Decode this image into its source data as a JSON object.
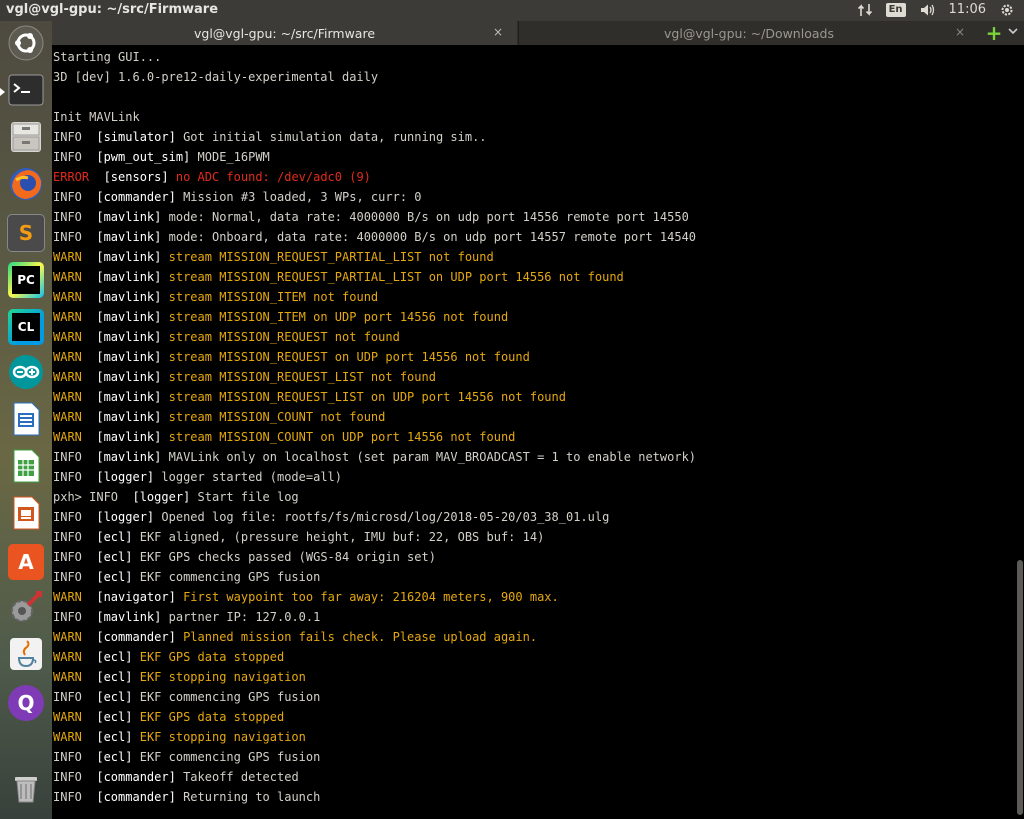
{
  "top_panel": {
    "window_title": "vgl@vgl-gpu: ~/src/Firmware",
    "keyboard_layout": "En",
    "clock": "11:06"
  },
  "launcher": {
    "items": [
      {
        "name": "ubuntu-dash-icon"
      },
      {
        "name": "terminal-icon"
      },
      {
        "name": "files-icon"
      },
      {
        "name": "firefox-icon"
      },
      {
        "name": "sublime-text-icon",
        "glyph": "S"
      },
      {
        "name": "pycharm-icon",
        "glyph": "PC"
      },
      {
        "name": "clion-icon",
        "glyph": "CL"
      },
      {
        "name": "arduino-icon"
      },
      {
        "name": "libreoffice-writer-icon"
      },
      {
        "name": "libreoffice-calc-icon"
      },
      {
        "name": "libreoffice-impress-icon"
      },
      {
        "name": "software-center-icon",
        "glyph": "A"
      },
      {
        "name": "system-settings-icon"
      },
      {
        "name": "java-icon"
      },
      {
        "name": "qgroundcontrol-icon",
        "glyph": "Q"
      },
      {
        "name": "trash-icon"
      }
    ]
  },
  "tabs": [
    {
      "label": "vgl@vgl-gpu: ~/src/Firmware",
      "close": "×"
    },
    {
      "label": "vgl@vgl-gpu: ~/Downloads",
      "close": "×"
    }
  ],
  "colors": {
    "warn": "#e5a80f",
    "error": "#e22a1b",
    "info": "#d3d0c8",
    "module": "#ffffff"
  },
  "lines": [
    {
      "plain": "Starting GUI..."
    },
    {
      "plain": "3D [dev] 1.6.0-pre12-daily-experimental daily"
    },
    {
      "plain": ""
    },
    {
      "plain": "Init MAVLink"
    },
    {
      "level": "INFO",
      "module": "[simulator]",
      "msg": "Got initial simulation data, running sim.."
    },
    {
      "level": "INFO",
      "module": "[pwm_out_sim]",
      "msg": "MODE_16PWM"
    },
    {
      "level": "ERROR",
      "module": "[sensors]",
      "msg": "no ADC found: /dev/adc0 (9)"
    },
    {
      "level": "INFO",
      "module": "[commander]",
      "msg": "Mission #3 loaded, 3 WPs, curr: 0"
    },
    {
      "level": "INFO",
      "module": "[mavlink]",
      "msg": "mode: Normal, data rate: 4000000 B/s on udp port 14556 remote port 14550"
    },
    {
      "level": "INFO",
      "module": "[mavlink]",
      "msg": "mode: Onboard, data rate: 4000000 B/s on udp port 14557 remote port 14540"
    },
    {
      "level": "WARN",
      "module": "[mavlink]",
      "msg": "stream MISSION_REQUEST_PARTIAL_LIST not found"
    },
    {
      "level": "WARN",
      "module": "[mavlink]",
      "msg": "stream MISSION_REQUEST_PARTIAL_LIST on UDP port 14556 not found"
    },
    {
      "level": "WARN",
      "module": "[mavlink]",
      "msg": "stream MISSION_ITEM not found"
    },
    {
      "level": "WARN",
      "module": "[mavlink]",
      "msg": "stream MISSION_ITEM on UDP port 14556 not found"
    },
    {
      "level": "WARN",
      "module": "[mavlink]",
      "msg": "stream MISSION_REQUEST not found"
    },
    {
      "level": "WARN",
      "module": "[mavlink]",
      "msg": "stream MISSION_REQUEST on UDP port 14556 not found"
    },
    {
      "level": "WARN",
      "module": "[mavlink]",
      "msg": "stream MISSION_REQUEST_LIST not found"
    },
    {
      "level": "WARN",
      "module": "[mavlink]",
      "msg": "stream MISSION_REQUEST_LIST on UDP port 14556 not found"
    },
    {
      "level": "WARN",
      "module": "[mavlink]",
      "msg": "stream MISSION_COUNT not found"
    },
    {
      "level": "WARN",
      "module": "[mavlink]",
      "msg": "stream MISSION_COUNT on UDP port 14556 not found"
    },
    {
      "level": "INFO",
      "module": "[mavlink]",
      "msg": "MAVLink only on localhost (set param MAV_BROADCAST = 1 to enable network)"
    },
    {
      "level": "INFO",
      "module": "[logger]",
      "msg": "logger started (mode=all)"
    },
    {
      "prompt": "pxh> ",
      "level": "INFO",
      "module": "[logger]",
      "msg": "Start file log"
    },
    {
      "level": "INFO",
      "module": "[logger]",
      "msg": "Opened log file: rootfs/fs/microsd/log/2018-05-20/03_38_01.ulg"
    },
    {
      "level": "INFO",
      "module": "[ecl]",
      "msg": "EKF aligned, (pressure height, IMU buf: 22, OBS buf: 14)"
    },
    {
      "level": "INFO",
      "module": "[ecl]",
      "msg": "EKF GPS checks passed (WGS-84 origin set)"
    },
    {
      "level": "INFO",
      "module": "[ecl]",
      "msg": "EKF commencing GPS fusion"
    },
    {
      "level": "WARN",
      "module": "[navigator]",
      "msg": "First waypoint too far away: 216204 meters, 900 max."
    },
    {
      "level": "INFO",
      "module": "[mavlink]",
      "msg": "partner IP: 127.0.0.1"
    },
    {
      "level": "WARN",
      "module": "[commander]",
      "msg": "Planned mission fails check. Please upload again."
    },
    {
      "level": "WARN",
      "module": "[ecl]",
      "msg": "EKF GPS data stopped"
    },
    {
      "level": "WARN",
      "module": "[ecl]",
      "msg": "EKF stopping navigation"
    },
    {
      "level": "INFO",
      "module": "[ecl]",
      "msg": "EKF commencing GPS fusion"
    },
    {
      "level": "WARN",
      "module": "[ecl]",
      "msg": "EKF GPS data stopped"
    },
    {
      "level": "WARN",
      "module": "[ecl]",
      "msg": "EKF stopping navigation"
    },
    {
      "level": "INFO",
      "module": "[ecl]",
      "msg": "EKF commencing GPS fusion"
    },
    {
      "level": "INFO",
      "module": "[commander]",
      "msg": "Takeoff detected"
    },
    {
      "level": "INFO",
      "module": "[commander]",
      "msg": "Returning to launch"
    }
  ]
}
